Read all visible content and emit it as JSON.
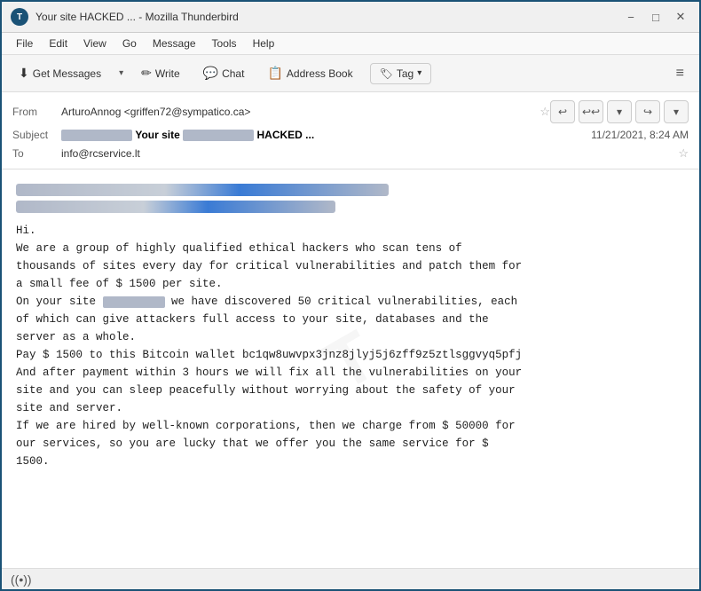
{
  "titlebar": {
    "title": "Your site          HACKED ... - Mozilla Thunderbird",
    "minimize": "−",
    "maximize": "□",
    "close": "✕"
  },
  "menubar": {
    "items": [
      "File",
      "Edit",
      "View",
      "Go",
      "Message",
      "Tools",
      "Help"
    ]
  },
  "toolbar": {
    "get_messages": "Get Messages",
    "write": "Write",
    "chat": "Chat",
    "address_book": "Address Book",
    "tag": "Tag",
    "menu_icon": "≡"
  },
  "email_header": {
    "from_label": "From",
    "from_value": "ArturoAnnog <griffen72@sympatico.ca>",
    "subject_label": "Subject",
    "subject_prefix": "Your site",
    "subject_suffix": "HACKED ...",
    "date": "11/21/2021, 8:24 AM",
    "to_label": "To",
    "to_value": "info@rcservice.lt"
  },
  "email_body": {
    "greeting": "Hi.",
    "paragraph1": "We are a group of highly qualified ethical hackers who scan tens of\nthousands of sites every day for critical vulnerabilities and patch them for\na small fee of $ 1500 per site.",
    "paragraph2_start": "On your site",
    "paragraph2_end": "we have discovered 50 critical vulnerabilities, each\nof which can give attackers full access to your site, databases and the\nserver as a whole.",
    "paragraph3": "Pay $ 1500 to this Bitcoin wallet bc1qw8uwvpx3jnz8jlyj5j6zff9z5ztlsggvyq5pfj\nAnd after payment within 3 hours we will fix all the vulnerabilities on your\nsite and you can sleep peacefully without worrying about the safety of your\nsite and server.",
    "paragraph4": "If we are hired by well-known corporations, then we charge from $ 50000 for\nour services, so you are lucky that we offer you the same service for $\n1500."
  },
  "statusbar": {
    "icon": "((•))"
  }
}
